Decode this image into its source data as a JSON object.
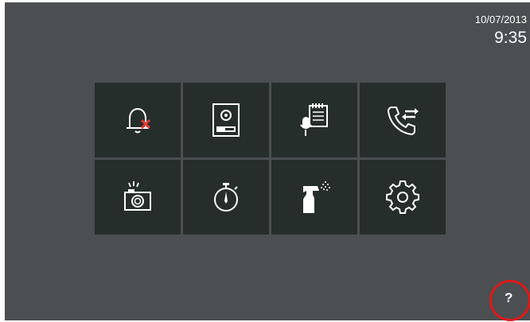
{
  "status": {
    "date": "10/07/2013",
    "time": "9:35"
  },
  "menu": {
    "tiles": [
      {
        "icon": "bell-muted-icon"
      },
      {
        "icon": "door-panel-icon"
      },
      {
        "icon": "voice-memo-icon"
      },
      {
        "icon": "call-transfer-icon"
      },
      {
        "icon": "camera-icon"
      },
      {
        "icon": "stopwatch-icon"
      },
      {
        "icon": "cleaning-spray-icon"
      },
      {
        "icon": "gear-icon"
      }
    ]
  },
  "help": {
    "label": "?",
    "highlight_color": "#e01818"
  },
  "colors": {
    "screen_bg": "#4b4f51",
    "tile_bg": "#252e2b",
    "icon": "#ffffff",
    "mute_cross": "#e53a2f"
  }
}
